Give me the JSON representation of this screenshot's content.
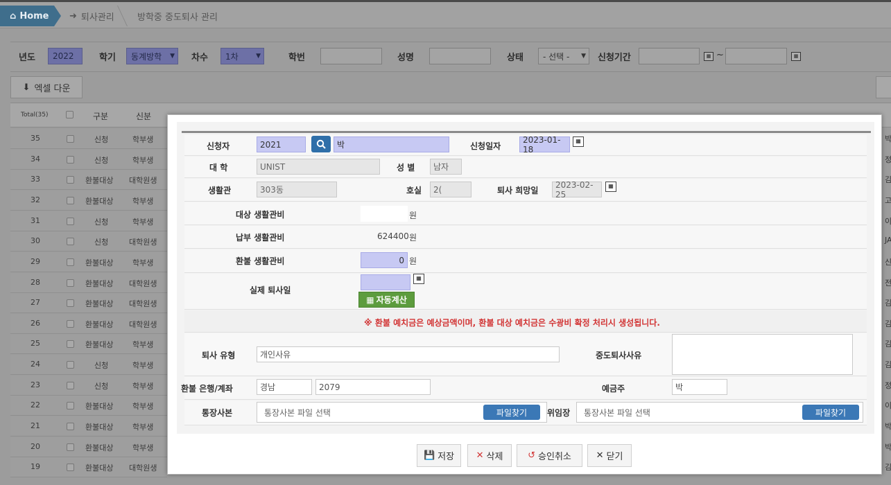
{
  "breadcrumb": {
    "home": "Home",
    "level1": "퇴사관리",
    "level2": "방학중 중도퇴사 관리"
  },
  "filter": {
    "year_label": "년도",
    "year_value": "2022",
    "semester_label": "학기",
    "semester_value": "동계방학",
    "round_label": "차수",
    "round_value": "1차",
    "student_no_label": "학번",
    "name_label": "성명",
    "status_label": "상태",
    "status_value": "- 선택 -",
    "period_label": "신청기간",
    "period_sep": "~"
  },
  "toolbar": {
    "excel_label": "엑셀 다운"
  },
  "grid": {
    "total_label": "Total(35)",
    "headers": {
      "type": "구분",
      "status": "신분"
    },
    "rows": [
      {
        "no": "35",
        "type": "신청",
        "status": "학부생",
        "tail": "박"
      },
      {
        "no": "34",
        "type": "신청",
        "status": "학부생",
        "tail": "정"
      },
      {
        "no": "33",
        "type": "환불대상",
        "status": "대학원생",
        "tail": "김"
      },
      {
        "no": "32",
        "type": "환불대상",
        "status": "학부생",
        "tail": "고"
      },
      {
        "no": "31",
        "type": "신청",
        "status": "학부생",
        "tail": "이"
      },
      {
        "no": "30",
        "type": "신청",
        "status": "대학원생",
        "tail": "JA"
      },
      {
        "no": "29",
        "type": "환불대상",
        "status": "학부생",
        "tail": "신"
      },
      {
        "no": "28",
        "type": "환불대상",
        "status": "대학원생",
        "tail": "전"
      },
      {
        "no": "27",
        "type": "환불대상",
        "status": "대학원생",
        "tail": "김"
      },
      {
        "no": "26",
        "type": "환불대상",
        "status": "대학원생",
        "tail": "김"
      },
      {
        "no": "25",
        "type": "환불대상",
        "status": "학부생",
        "tail": "김"
      },
      {
        "no": "24",
        "type": "신청",
        "status": "학부생",
        "tail": "김"
      },
      {
        "no": "23",
        "type": "신청",
        "status": "학부생",
        "tail": "정"
      },
      {
        "no": "22",
        "type": "환불대상",
        "status": "학부생",
        "tail": "이"
      },
      {
        "no": "21",
        "type": "환불대상",
        "status": "학부생",
        "tail": "박"
      },
      {
        "no": "20",
        "type": "환불대상",
        "status": "학부생",
        "tail": "박"
      },
      {
        "no": "19",
        "type": "환불대상",
        "status": "대학원생",
        "tail": "김"
      }
    ]
  },
  "modal": {
    "applicant_label": "신청자",
    "applicant_id": "2021",
    "applicant_name": "박",
    "apply_date_label": "신청일자",
    "apply_date": "2023-01-18",
    "university_label": "대 학",
    "university": "UNIST",
    "gender_label": "성 별",
    "gender": "남자",
    "dorm_label": "생활관",
    "dorm": "303동",
    "room_label": "호실",
    "room": "2(",
    "desired_date_label": "퇴사 희망일",
    "desired_date": "2023-02-25",
    "target_fee_label": "대상 생활관비",
    "target_fee": "",
    "paid_fee_label": "납부 생활관비",
    "paid_fee": "624400",
    "refund_fee_label": "환불 생활관비",
    "refund_fee": "0",
    "currency": "원",
    "actual_date_label": "실제 퇴사일",
    "actual_date": "",
    "auto_calc_label": "자동계산",
    "notice": "※ 환불 예치금은 예상금액이며, 환불 대상 예치금은 수광비 확정 처리시 생성됩니다.",
    "leave_type_label": "퇴사 유형",
    "leave_type": "개인사유",
    "leave_reason_label": "중도퇴사사유",
    "bank_label": "환불 은행/계좌",
    "bank": "경남",
    "account": "2079",
    "holder_label": "예금주",
    "holder": "박",
    "bankbook_label": "통장사본",
    "bankbook_placeholder": "통장사본 파일 선택",
    "proxy_label": "위임장",
    "proxy_placeholder": "통장사본 파일 선택",
    "file_button": "파일찾기"
  },
  "footer": {
    "save": "저장",
    "delete": "삭제",
    "cancel_approval": "승인취소",
    "close": "닫기"
  }
}
